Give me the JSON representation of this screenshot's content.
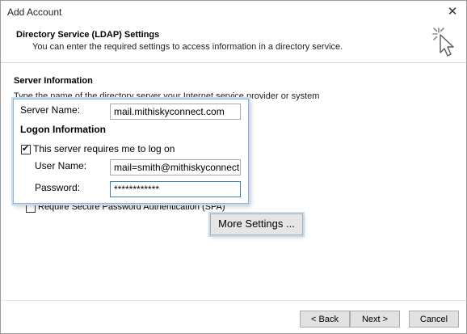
{
  "window": {
    "title": "Add Account",
    "close_glyph": "✕"
  },
  "header": {
    "title": "Directory Service (LDAP) Settings",
    "subtitle": "You can enter the required settings to access information in a directory service.",
    "icon": "wizard-cursor-icon"
  },
  "server_info": {
    "title": "Server Information",
    "description": "Type the name of the directory server your Internet service provider or system"
  },
  "form": {
    "server_name_label": "Server Name:",
    "server_name_value": "mail.mithiskyconnect.com",
    "logon_title": "Logon Information",
    "requires_logon_label": "This server requires me to log on",
    "requires_logon_checked": true,
    "user_name_label": "User Name:",
    "user_name_value": "mail=smith@mithiskyconnect.c",
    "password_label": "Password:",
    "password_value": "************",
    "spa_label": "Require Secure Password Authentication (SPA)",
    "spa_checked": false
  },
  "buttons": {
    "more_settings": "More Settings ...",
    "back": "< Back",
    "next": "Next >",
    "cancel": "Cancel"
  }
}
